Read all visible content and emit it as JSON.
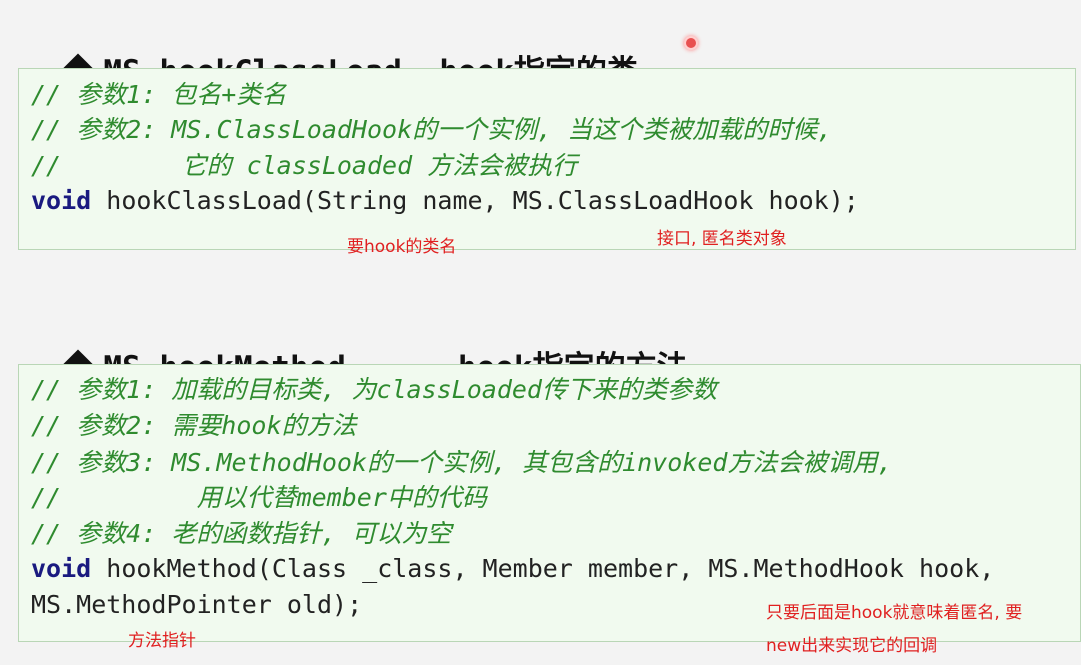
{
  "section1": {
    "title": "MS.hookClassLoad, hook指定的类",
    "comment1": "// 参数1: 包名+类名",
    "comment2": "// 参数2: MS.ClassLoadHook的一个实例, 当这个类被加载的时候,",
    "comment3": "//        它的 classLoaded 方法会被执行",
    "code_kw": "void",
    "code_rest": " hookClassLoad(String name, MS.ClassLoadHook hook);",
    "note_name": "要hook的类名",
    "note_iface": "接口, 匿名类对象"
  },
  "section2": {
    "title": "MS.hookMethod      hook指定的方法",
    "comment1": "// 参数1: 加载的目标类, 为classLoaded传下来的类参数",
    "comment2": "// 参数2: 需要hook的方法",
    "comment3": "// 参数3: MS.MethodHook的一个实例, 其包含的invoked方法会被调用,",
    "comment4": "//         用以代替member中的代码",
    "comment5": "// 参数4: 老的函数指针, 可以为空",
    "code_kw": "void",
    "code_rest": " hookMethod(Class _class, Member member, MS.MethodHook hook,",
    "code_line2": "MS.MethodPointer old);",
    "note_pointer": "方法指针",
    "note_hook_line1": "只要后面是hook就意味着匿名, 要",
    "note_hook_line2": "new出来实现它的回调"
  }
}
